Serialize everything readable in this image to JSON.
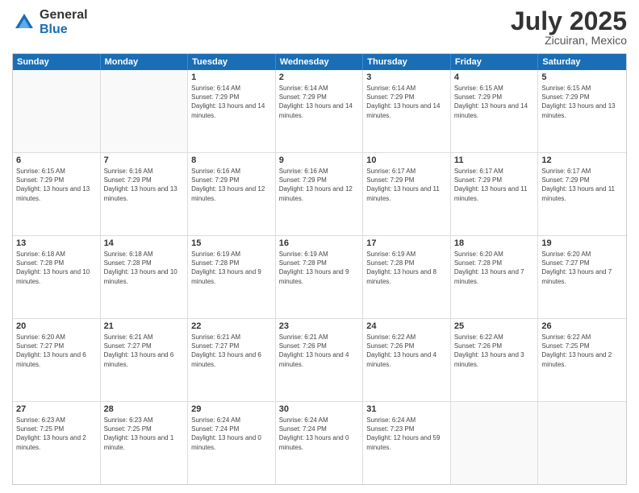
{
  "header": {
    "logo_general": "General",
    "logo_blue": "Blue",
    "title": "July 2025",
    "location": "Zicuiran, Mexico"
  },
  "days_of_week": [
    "Sunday",
    "Monday",
    "Tuesday",
    "Wednesday",
    "Thursday",
    "Friday",
    "Saturday"
  ],
  "weeks": [
    [
      {
        "day": "",
        "info": ""
      },
      {
        "day": "",
        "info": ""
      },
      {
        "day": "1",
        "info": "Sunrise: 6:14 AM\nSunset: 7:29 PM\nDaylight: 13 hours and 14 minutes."
      },
      {
        "day": "2",
        "info": "Sunrise: 6:14 AM\nSunset: 7:29 PM\nDaylight: 13 hours and 14 minutes."
      },
      {
        "day": "3",
        "info": "Sunrise: 6:14 AM\nSunset: 7:29 PM\nDaylight: 13 hours and 14 minutes."
      },
      {
        "day": "4",
        "info": "Sunrise: 6:15 AM\nSunset: 7:29 PM\nDaylight: 13 hours and 14 minutes."
      },
      {
        "day": "5",
        "info": "Sunrise: 6:15 AM\nSunset: 7:29 PM\nDaylight: 13 hours and 13 minutes."
      }
    ],
    [
      {
        "day": "6",
        "info": "Sunrise: 6:15 AM\nSunset: 7:29 PM\nDaylight: 13 hours and 13 minutes."
      },
      {
        "day": "7",
        "info": "Sunrise: 6:16 AM\nSunset: 7:29 PM\nDaylight: 13 hours and 13 minutes."
      },
      {
        "day": "8",
        "info": "Sunrise: 6:16 AM\nSunset: 7:29 PM\nDaylight: 13 hours and 12 minutes."
      },
      {
        "day": "9",
        "info": "Sunrise: 6:16 AM\nSunset: 7:29 PM\nDaylight: 13 hours and 12 minutes."
      },
      {
        "day": "10",
        "info": "Sunrise: 6:17 AM\nSunset: 7:29 PM\nDaylight: 13 hours and 11 minutes."
      },
      {
        "day": "11",
        "info": "Sunrise: 6:17 AM\nSunset: 7:29 PM\nDaylight: 13 hours and 11 minutes."
      },
      {
        "day": "12",
        "info": "Sunrise: 6:17 AM\nSunset: 7:29 PM\nDaylight: 13 hours and 11 minutes."
      }
    ],
    [
      {
        "day": "13",
        "info": "Sunrise: 6:18 AM\nSunset: 7:28 PM\nDaylight: 13 hours and 10 minutes."
      },
      {
        "day": "14",
        "info": "Sunrise: 6:18 AM\nSunset: 7:28 PM\nDaylight: 13 hours and 10 minutes."
      },
      {
        "day": "15",
        "info": "Sunrise: 6:19 AM\nSunset: 7:28 PM\nDaylight: 13 hours and 9 minutes."
      },
      {
        "day": "16",
        "info": "Sunrise: 6:19 AM\nSunset: 7:28 PM\nDaylight: 13 hours and 9 minutes."
      },
      {
        "day": "17",
        "info": "Sunrise: 6:19 AM\nSunset: 7:28 PM\nDaylight: 13 hours and 8 minutes."
      },
      {
        "day": "18",
        "info": "Sunrise: 6:20 AM\nSunset: 7:28 PM\nDaylight: 13 hours and 7 minutes."
      },
      {
        "day": "19",
        "info": "Sunrise: 6:20 AM\nSunset: 7:27 PM\nDaylight: 13 hours and 7 minutes."
      }
    ],
    [
      {
        "day": "20",
        "info": "Sunrise: 6:20 AM\nSunset: 7:27 PM\nDaylight: 13 hours and 6 minutes."
      },
      {
        "day": "21",
        "info": "Sunrise: 6:21 AM\nSunset: 7:27 PM\nDaylight: 13 hours and 6 minutes."
      },
      {
        "day": "22",
        "info": "Sunrise: 6:21 AM\nSunset: 7:27 PM\nDaylight: 13 hours and 6 minutes."
      },
      {
        "day": "23",
        "info": "Sunrise: 6:21 AM\nSunset: 7:26 PM\nDaylight: 13 hours and 4 minutes."
      },
      {
        "day": "24",
        "info": "Sunrise: 6:22 AM\nSunset: 7:26 PM\nDaylight: 13 hours and 4 minutes."
      },
      {
        "day": "25",
        "info": "Sunrise: 6:22 AM\nSunset: 7:26 PM\nDaylight: 13 hours and 3 minutes."
      },
      {
        "day": "26",
        "info": "Sunrise: 6:22 AM\nSunset: 7:25 PM\nDaylight: 13 hours and 2 minutes."
      }
    ],
    [
      {
        "day": "27",
        "info": "Sunrise: 6:23 AM\nSunset: 7:25 PM\nDaylight: 13 hours and 2 minutes."
      },
      {
        "day": "28",
        "info": "Sunrise: 6:23 AM\nSunset: 7:25 PM\nDaylight: 13 hours and 1 minute."
      },
      {
        "day": "29",
        "info": "Sunrise: 6:24 AM\nSunset: 7:24 PM\nDaylight: 13 hours and 0 minutes."
      },
      {
        "day": "30",
        "info": "Sunrise: 6:24 AM\nSunset: 7:24 PM\nDaylight: 13 hours and 0 minutes."
      },
      {
        "day": "31",
        "info": "Sunrise: 6:24 AM\nSunset: 7:23 PM\nDaylight: 12 hours and 59 minutes."
      },
      {
        "day": "",
        "info": ""
      },
      {
        "day": "",
        "info": ""
      }
    ]
  ]
}
